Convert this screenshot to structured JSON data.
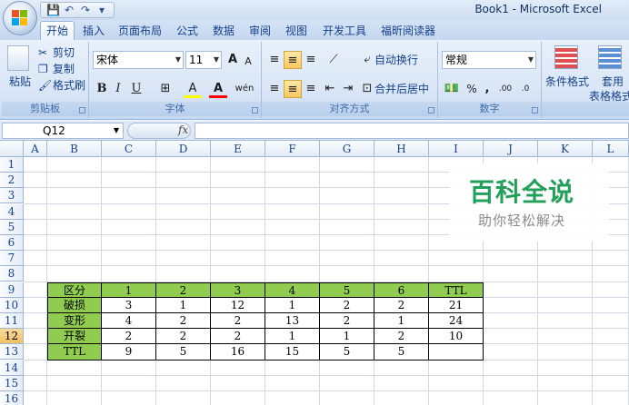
{
  "window": {
    "title": "Book1 - Microsoft Excel"
  },
  "qat": {
    "save_icon": "save-icon",
    "undo_icon": "undo-icon",
    "redo_icon": "redo-icon",
    "customize_icon": "customize-icon"
  },
  "tabs": [
    "开始",
    "插入",
    "页面布局",
    "公式",
    "数据",
    "审阅",
    "视图",
    "开发工具",
    "福昕阅读器"
  ],
  "ribbon": {
    "clipboard": {
      "paste": "粘贴",
      "cut": "剪切",
      "copy": "复制",
      "format_painter": "格式刷",
      "label": "剪贴板"
    },
    "font": {
      "name": "宋体",
      "size": "11",
      "grow": "A",
      "shrink": "A",
      "bold": "B",
      "italic": "I",
      "underline": "U",
      "border": "⊞",
      "fill": "A",
      "color": "A",
      "phonetic": "wén",
      "label": "字体"
    },
    "alignment": {
      "wrap": "自动换行",
      "merge": "合并后居中",
      "label": "对齐方式"
    },
    "number": {
      "format": "常规",
      "percent": "%",
      "comma": ",",
      "inc_dec": ".00",
      "dec_dec": ".0",
      "label": "数字"
    },
    "styles": {
      "conditional": "条件格式",
      "table_format_1": "套用",
      "table_format_2": "表格格式"
    }
  },
  "formula_bar": {
    "name_box": "Q12",
    "fx": "fx",
    "formula": ""
  },
  "columns": [
    "A",
    "B",
    "C",
    "D",
    "E",
    "F",
    "G",
    "H",
    "I",
    "J",
    "K",
    "L"
  ],
  "rows": [
    "1",
    "2",
    "3",
    "4",
    "5",
    "6",
    "7",
    "8",
    "9",
    "10",
    "11",
    "12",
    "13",
    "14",
    "15",
    "16"
  ],
  "active_row": "12",
  "table": {
    "header": [
      "区分",
      "1",
      "2",
      "3",
      "4",
      "5",
      "6",
      "TTL"
    ],
    "rows": [
      [
        "破损",
        "3",
        "1",
        "12",
        "1",
        "2",
        "2",
        "21"
      ],
      [
        "变形",
        "4",
        "2",
        "2",
        "13",
        "2",
        "1",
        "24"
      ],
      [
        "开裂",
        "2",
        "2",
        "2",
        "1",
        "1",
        "2",
        "10"
      ],
      [
        "TTL",
        "9",
        "5",
        "16",
        "15",
        "5",
        "5",
        ""
      ]
    ]
  },
  "watermark": {
    "main": "百科全说",
    "sub": "助你轻松解决"
  },
  "colors": {
    "accent_green": "#8fcc4f",
    "ribbon_blue": "#15428b",
    "watermark_green": "#22a05a"
  }
}
